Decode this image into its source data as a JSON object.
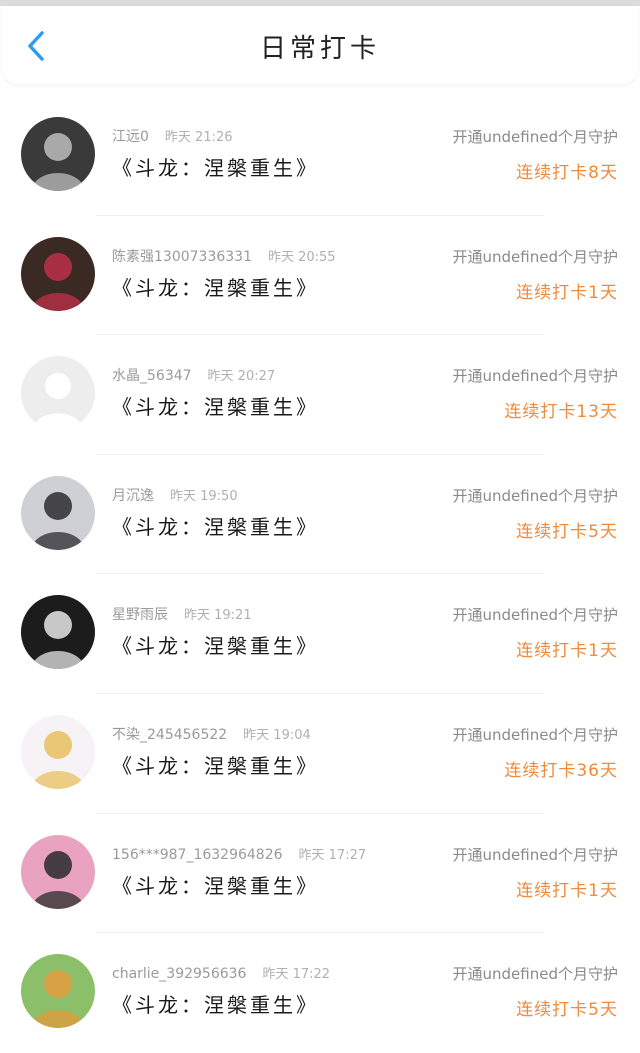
{
  "header": {
    "back_icon": "chevron-left-icon",
    "title": "日常打卡",
    "accent_color": "#2d9cf0"
  },
  "colors": {
    "streak": "#f08a3c",
    "guard_text": "#8a8a8a"
  },
  "entries": [
    {
      "user": "江远0",
      "time": "昨天 21:26",
      "work": "《斗龙：涅槃重生》",
      "guard": "开通undefined个月守护",
      "streak": "连续打卡8天",
      "avatar": {
        "name": "avatar-dark-sunglasses",
        "bg": "#3a3a3a",
        "fg": "#bdbdbd"
      }
    },
    {
      "user": "陈素强13007336331",
      "time": "昨天 20:55",
      "work": "《斗龙：涅槃重生》",
      "guard": "开通undefined个月守护",
      "streak": "连续打卡1天",
      "avatar": {
        "name": "avatar-girl-red-dress",
        "bg": "#3b2a24",
        "fg": "#c0304a"
      }
    },
    {
      "user": "水晶_56347",
      "time": "昨天 20:27",
      "work": "《斗龙：涅槃重生》",
      "guard": "开通undefined个月守护",
      "streak": "连续打卡13天",
      "avatar": {
        "name": "avatar-default-placeholder",
        "bg": "#ededed",
        "fg": "#ffffff"
      }
    },
    {
      "user": "月沉逸",
      "time": "昨天 19:50",
      "work": "《斗龙：涅槃重生》",
      "guard": "开通undefined个月守护",
      "streak": "连续打卡5天",
      "avatar": {
        "name": "avatar-anime-boy",
        "bg": "#cfcfd6",
        "fg": "#2b2b30"
      }
    },
    {
      "user": "星野雨辰",
      "time": "昨天 19:21",
      "work": "《斗龙：涅槃重生》",
      "guard": "开通undefined个月守护",
      "streak": "连续打卡1天",
      "avatar": {
        "name": "avatar-anime-dark",
        "bg": "#1c1c1c",
        "fg": "#e6e6e6"
      }
    },
    {
      "user": "不染_245456522",
      "time": "昨天 19:04",
      "work": "《斗龙：涅槃重生》",
      "guard": "开通undefined个月守护",
      "streak": "连续打卡36天",
      "avatar": {
        "name": "avatar-anime-white-hair",
        "bg": "#f6f2f6",
        "fg": "#e8c060"
      }
    },
    {
      "user": "156***987_1632964826",
      "time": "昨天 17:27",
      "work": "《斗龙：涅槃重生》",
      "guard": "开通undefined个月守护",
      "streak": "连续打卡1天",
      "avatar": {
        "name": "avatar-boy-cat-ears",
        "bg": "#e9a3c0",
        "fg": "#2a2a2a"
      }
    },
    {
      "user": "charlie_392956636",
      "time": "昨天 17:22",
      "work": "《斗龙：涅槃重生》",
      "guard": "开通undefined个月守护",
      "streak": "连续打卡5天",
      "avatar": {
        "name": "avatar-corgi-dog",
        "bg": "#8bbf6a",
        "fg": "#e39a3e"
      }
    }
  ]
}
